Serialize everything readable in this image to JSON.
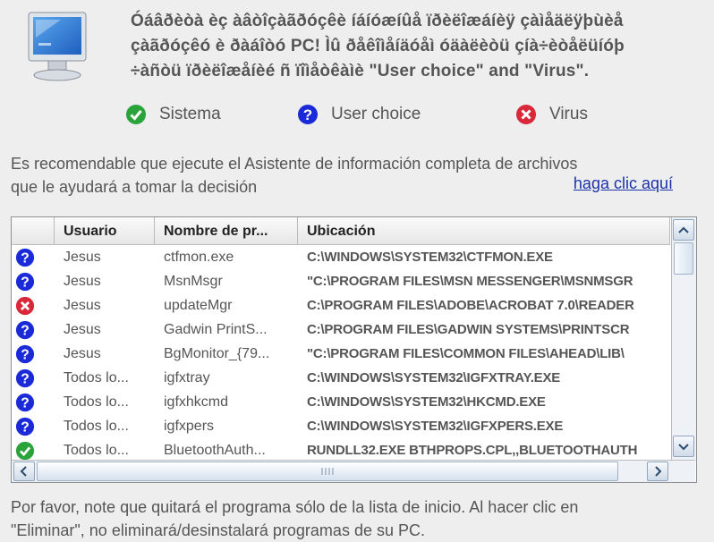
{
  "header": {
    "icon": "monitor-icon",
    "line1": "Óáâðèòà èç àâòîçàãðóçêè íáíóæíûå ïðèëîæáíèÿ çàìåäëÿþùèå",
    "line2": "çàãðóçêó è ðàáîòó PC! Ìû ðåêîìåíäóåì óäàëèòü çíà÷èòåëüíóþ",
    "line3": "÷àñòü ïðèëîæåíèé ñ ïîìåòêàìè \"User choice\" and \"Virus\"."
  },
  "legend": [
    {
      "icon": "check-icon",
      "label": "Sistema"
    },
    {
      "icon": "question-icon",
      "label": "User choice"
    },
    {
      "icon": "virus-x-icon",
      "label": "Virus"
    }
  ],
  "description": {
    "line1": "Es recomendable que ejecute el Asistente de información completa de archivos",
    "line2": "que le ayudará a tomar la decisión",
    "link": "haga clic aquí"
  },
  "table": {
    "columns": [
      "",
      "Usuario",
      "Nombre de pr...",
      "Ubicación"
    ],
    "rows": [
      {
        "status": "question",
        "user": "Jesus",
        "name": "ctfmon.exe",
        "location": "C:\\WINDOWS\\SYSTEM32\\CTFMON.EXE"
      },
      {
        "status": "question",
        "user": "Jesus",
        "name": "MsnMsgr",
        "location": "\"C:\\PROGRAM FILES\\MSN MESSENGER\\MSNMSGR"
      },
      {
        "status": "virus",
        "user": "Jesus",
        "name": "updateMgr",
        "location": "C:\\PROGRAM FILES\\ADOBE\\ACROBAT 7.0\\READER"
      },
      {
        "status": "question",
        "user": "Jesus",
        "name": "Gadwin PrintS...",
        "location": "C:\\PROGRAM FILES\\GADWIN SYSTEMS\\PRINTSCR"
      },
      {
        "status": "question",
        "user": "Jesus",
        "name": "BgMonitor_{79...",
        "location": "\"C:\\PROGRAM FILES\\COMMON FILES\\AHEAD\\LIB\\"
      },
      {
        "status": "question",
        "user": "Todos lo...",
        "name": "igfxtray",
        "location": "C:\\WINDOWS\\SYSTEM32\\IGFXTRAY.EXE"
      },
      {
        "status": "question",
        "user": "Todos lo...",
        "name": "igfxhkcmd",
        "location": "C:\\WINDOWS\\SYSTEM32\\HKCMD.EXE"
      },
      {
        "status": "question",
        "user": "Todos lo...",
        "name": "igfxpers",
        "location": "C:\\WINDOWS\\SYSTEM32\\IGFXPERS.EXE"
      },
      {
        "status": "check",
        "user": "Todos lo...",
        "name": "BluetoothAuth...",
        "location": "RUNDLL32.EXE BTHPROPS.CPL,,BLUETOOTHAUTH"
      }
    ]
  },
  "footer": {
    "line1": "Por favor, note que quitará el programa sólo de la lista de inicio. Al hacer clic en",
    "line2": "\"Eliminar\", no eliminará/desinstalará programas de su PC."
  },
  "colors": {
    "check": "#2aa33a",
    "question": "#1a2ad8",
    "virus": "#d8283a",
    "link": "#1a33a8"
  }
}
